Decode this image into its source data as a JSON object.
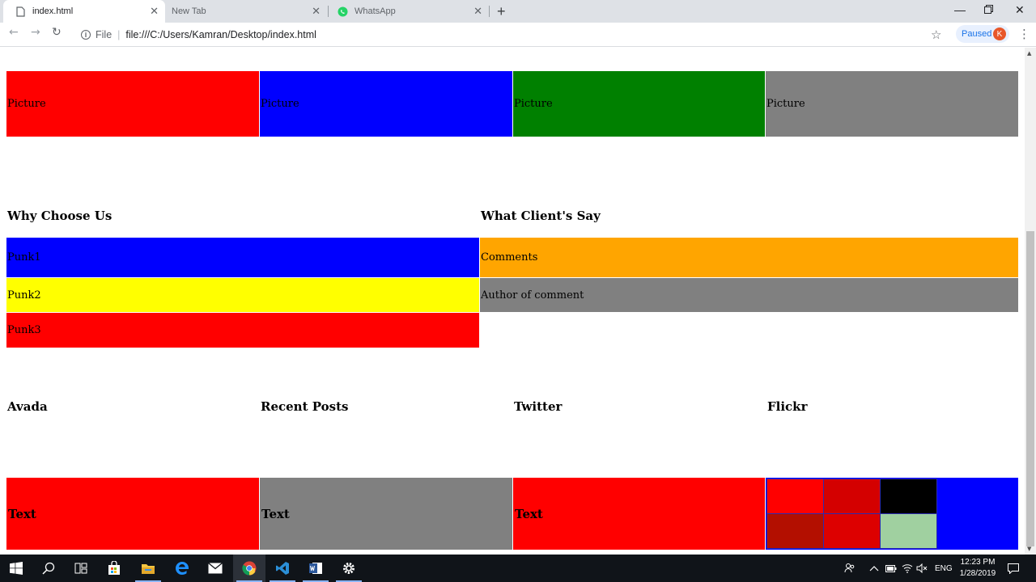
{
  "browser": {
    "tabs": [
      {
        "title": "index.html",
        "active": true
      },
      {
        "title": "New Tab",
        "active": false
      },
      {
        "title": "WhatsApp",
        "active": false
      }
    ],
    "address": {
      "scheme_label": "File",
      "url": "file:///C:/Users/Kamran/Desktop/index.html"
    },
    "profile": {
      "status": "Paused",
      "initial": "K"
    }
  },
  "page": {
    "pictures": [
      {
        "label": "Picture",
        "color": "#ff0000"
      },
      {
        "label": "Picture",
        "color": "#0000ff"
      },
      {
        "label": "Picture",
        "color": "#008000"
      },
      {
        "label": "Picture",
        "color": "#808080"
      }
    ],
    "why_choose_us": {
      "heading": "Why Choose Us",
      "items": [
        {
          "label": "Punk1",
          "color": "#0000ff"
        },
        {
          "label": "Punk2",
          "color": "#ffff00"
        },
        {
          "label": "Punk3",
          "color": "#ff0000"
        }
      ]
    },
    "clients": {
      "heading": "What Client's Say",
      "comment": {
        "label": "Comments",
        "color": "#ffa500"
      },
      "author": {
        "label": "Author of comment",
        "color": "#808080"
      }
    },
    "footer": {
      "headings": [
        "Avada",
        "Recent Posts",
        "Twitter",
        "Flickr"
      ],
      "boxes": [
        {
          "label": "Text",
          "color": "#ff0000"
        },
        {
          "label": "Text",
          "color": "#808080"
        },
        {
          "label": "Text",
          "color": "#ff0000"
        }
      ],
      "flickr_background": "#0000ff",
      "flickr_cells": [
        "#ff0000",
        "#d40000",
        "#000000",
        "#b30f00",
        "#dd0000",
        "#a0d0a0"
      ]
    }
  },
  "taskbar": {
    "apps": [
      "start-icon",
      "search-icon",
      "task-view-icon",
      "store-icon",
      "file-explorer-icon",
      "edge-icon",
      "mail-icon",
      "chrome-icon",
      "vscode-icon",
      "word-icon",
      "settings-icon"
    ],
    "language": "ENG",
    "time": "12:23 PM",
    "date": "1/28/2019"
  }
}
